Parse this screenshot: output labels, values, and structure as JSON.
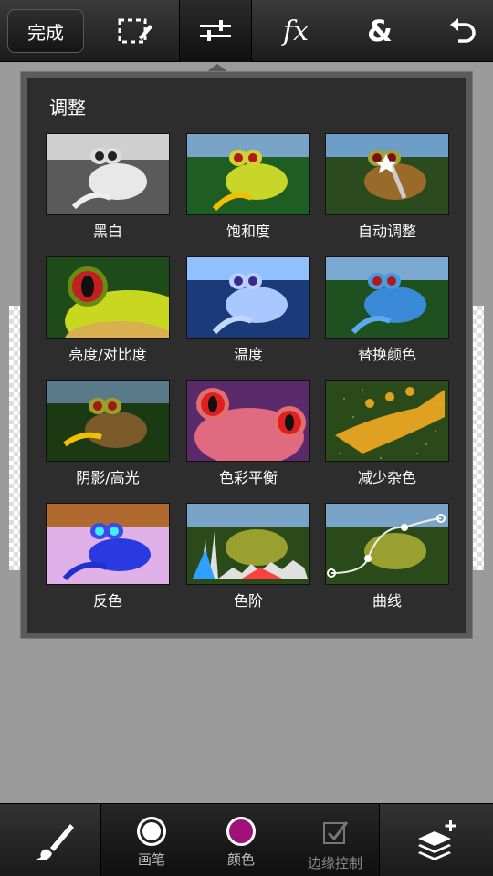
{
  "toolbar": {
    "done_label": "完成",
    "icons": [
      "selection-icon",
      "adjust-sliders-icon",
      "fx-icon",
      "ampersand-icon",
      "undo-icon"
    ],
    "fx_text": "fx",
    "amp_text": "&"
  },
  "panel": {
    "title": "调整",
    "tiles": [
      {
        "label": "黑白"
      },
      {
        "label": "饱和度"
      },
      {
        "label": "自动调整"
      },
      {
        "label": "亮度/对比度"
      },
      {
        "label": "温度"
      },
      {
        "label": "替换颜色"
      },
      {
        "label": "阴影/高光"
      },
      {
        "label": "色彩平衡"
      },
      {
        "label": "减少杂色"
      },
      {
        "label": "反色"
      },
      {
        "label": "色阶"
      },
      {
        "label": "曲线"
      }
    ]
  },
  "bottom": {
    "brush_label": "画笔",
    "color_label": "颜色",
    "edge_label": "边缘控制",
    "selected_color": "#a0127a"
  }
}
